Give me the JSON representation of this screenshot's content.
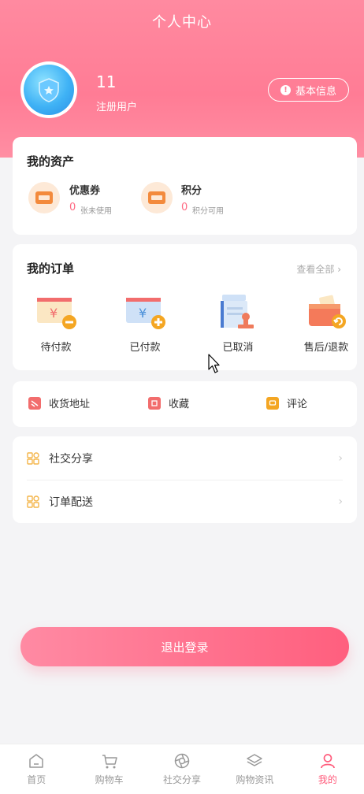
{
  "header": {
    "title": "个人中心"
  },
  "user": {
    "name": "11",
    "role": "注册用户",
    "info_button": "基本信息"
  },
  "assets": {
    "title": "我的资产",
    "items": [
      {
        "name": "优惠券",
        "value": "0",
        "sub": "张未使用"
      },
      {
        "name": "积分",
        "value": "0",
        "sub": "积分可用"
      }
    ]
  },
  "orders": {
    "title": "我的订单",
    "view_all": "查看全部",
    "items": [
      {
        "label": "待付款"
      },
      {
        "label": "已付款"
      },
      {
        "label": "已取消"
      },
      {
        "label": "售后/退款"
      }
    ]
  },
  "tools": {
    "items": [
      {
        "label": "收货地址"
      },
      {
        "label": "收藏"
      },
      {
        "label": "评论"
      }
    ]
  },
  "menu": {
    "items": [
      {
        "label": "社交分享"
      },
      {
        "label": "订单配送"
      }
    ]
  },
  "logout_label": "退出登录",
  "tabbar": {
    "items": [
      {
        "label": "首页"
      },
      {
        "label": "购物车"
      },
      {
        "label": "社交分享"
      },
      {
        "label": "购物资讯"
      },
      {
        "label": "我的"
      }
    ],
    "active_index": 4
  },
  "colors": {
    "brand": "#ff7c95",
    "accent": "#ff5c7c",
    "gold": "#f4a623"
  }
}
